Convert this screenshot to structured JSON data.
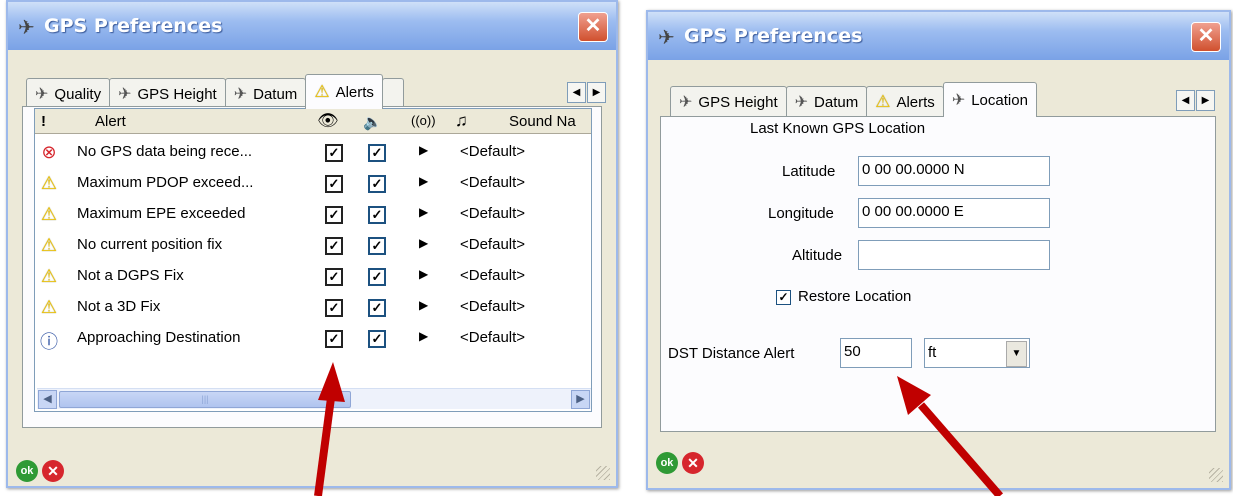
{
  "colors": {
    "arrow": "#c00000",
    "title_text": "#ffffff",
    "ok_green": "#2f9a35",
    "cancel_red": "#d6262d"
  },
  "window1": {
    "title": "GPS Preferences",
    "tabs": [
      {
        "label": "Quality",
        "icon": "satellite-icon"
      },
      {
        "label": "GPS Height",
        "icon": "satellite-icon"
      },
      {
        "label": "Datum",
        "icon": "satellite-icon"
      },
      {
        "label": "Alerts",
        "icon": "warning-icon",
        "active": true
      }
    ],
    "columns": {
      "priority": "!",
      "alert": "Alert",
      "sound_name": "Sound Na"
    },
    "rows": [
      {
        "icon": "error-icon",
        "text": "No GPS data being rece...",
        "sound": "<Default>"
      },
      {
        "icon": "warning-icon",
        "text": "Maximum PDOP exceed...",
        "sound": "<Default>"
      },
      {
        "icon": "warning-icon",
        "text": "Maximum EPE exceeded",
        "sound": "<Default>"
      },
      {
        "icon": "warning-icon",
        "text": "No current position fix",
        "sound": "<Default>"
      },
      {
        "icon": "warning-icon",
        "text": "Not a DGPS Fix",
        "sound": "<Default>"
      },
      {
        "icon": "warning-icon",
        "text": "Not a 3D Fix",
        "sound": "<Default>"
      },
      {
        "icon": "info-icon",
        "text": "Approaching Destination",
        "sound": "<Default>"
      }
    ],
    "ok_label": "ok"
  },
  "window2": {
    "title": "GPS Preferences",
    "tabs": [
      {
        "label": "GPS Height",
        "icon": "satellite-icon"
      },
      {
        "label": "Datum",
        "icon": "satellite-icon"
      },
      {
        "label": "Alerts",
        "icon": "warning-icon"
      },
      {
        "label": "Location",
        "icon": "satellite-icon",
        "active": true
      }
    ],
    "section_title": "Last Known GPS Location",
    "latitude_label": "Latitude",
    "latitude_value": "0 00 00.0000 N",
    "longitude_label": "Longitude",
    "longitude_value": "0 00 00.0000 E",
    "altitude_label": "Altitude",
    "altitude_value": "",
    "restore_label": "Restore Location",
    "restore_checked": true,
    "dst_label": "DST Distance Alert",
    "dst_value": "50",
    "dst_unit": "ft",
    "ok_label": "ok"
  }
}
